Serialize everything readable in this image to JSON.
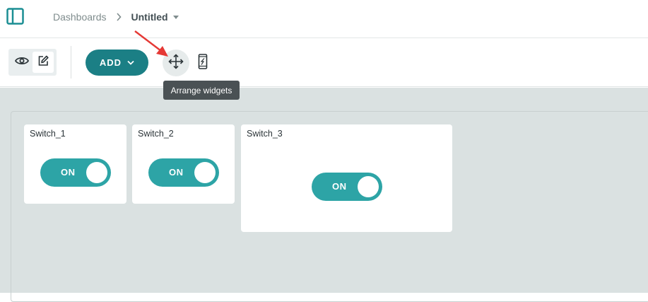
{
  "topbar": {
    "breadcrumb_root": "Dashboards",
    "breadcrumb_current": "Untitled",
    "icons": {
      "sidebar": "sidebar-toggle-icon",
      "separator": "chevron-right-icon",
      "caret": "caret-down-icon"
    }
  },
  "toolbar": {
    "add_label": "ADD",
    "arrange_tooltip": "Arrange widgets",
    "icons": {
      "view": "eye-icon",
      "edit": "edit-icon",
      "arrange": "move-arrows-icon",
      "mobile": "mobile-phone-icon"
    }
  },
  "widgets": [
    {
      "title": "Switch_1",
      "state": "ON"
    },
    {
      "title": "Switch_2",
      "state": "ON"
    },
    {
      "title": "Switch_3",
      "state": "ON"
    }
  ],
  "colors": {
    "accent": "#1b7f85",
    "toggle_on": "#2da4a6",
    "canvas": "#dae1e1",
    "tooltip": "#4a5154",
    "annotation_arrow": "#e53935"
  }
}
